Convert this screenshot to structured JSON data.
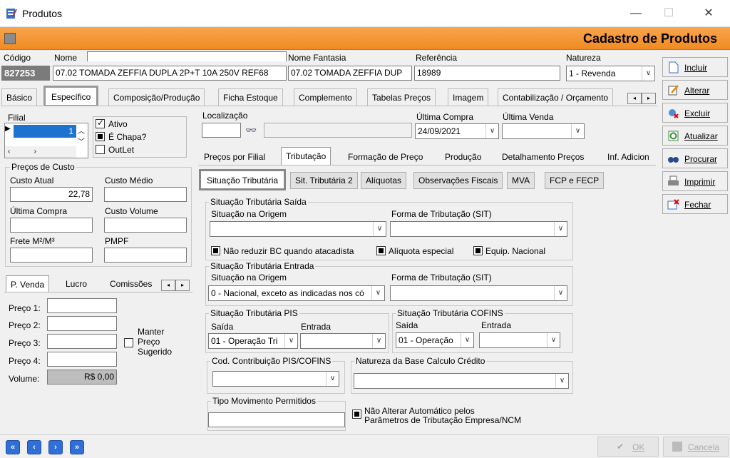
{
  "window": {
    "title": "Produtos"
  },
  "header": {
    "title": "Cadastro de Produtos"
  },
  "fields": {
    "codigo_label": "Código",
    "codigo": "827253",
    "nome_label": "Nome",
    "nome": "07.02 TOMADA ZEFFIA DUPLA 2P+T 10A 250V REF68",
    "fantasia_label": "Nome Fantasia",
    "fantasia": "07.02 TOMADA ZEFFIA DUP",
    "referencia_label": "Referência",
    "referencia": "18989",
    "natureza_label": "Natureza",
    "natureza": "1 - Revenda"
  },
  "tabs": [
    "Básico",
    "Específico",
    "Composição/Produção",
    "Ficha Estoque",
    "Complemento",
    "Tabelas Preços",
    "Imagem",
    "Contabilização / Orçamento"
  ],
  "left": {
    "filial_label": "Filial",
    "filial_value": "1",
    "ativo": "Ativo",
    "chapa": "É Chapa?",
    "outlet": "OutLet",
    "precos_custo": "Preços de Custo",
    "custo_atual_label": "Custo Atual",
    "custo_atual": "22,78",
    "custo_medio_label": "Custo Médio",
    "ultima_compra_label": "Última Compra",
    "custo_volume_label": "Custo Volume",
    "frete_label": "Frete M²/M³",
    "pmpf_label": "PMPF",
    "ptabs": [
      "P. Venda",
      "Lucro",
      "Comissões"
    ],
    "preco1": "Preço 1:",
    "preco2": "Preço 2:",
    "preco3": "Preço 3:",
    "preco4": "Preço 4:",
    "volume_label": "Volume:",
    "volume": "R$ 0,00",
    "manter": "Manter",
    "preco": "Preço",
    "sugerido": "Sugerido"
  },
  "right": {
    "localizacao": "Localização",
    "ultima_compra_label": "Última Compra",
    "ultima_compra": "24/09/2021",
    "ultima_venda_label": "Última Venda",
    "subtabs": [
      "Preços por Filial",
      "Tributação",
      "Formação de Preço",
      "Produção",
      "Detalhamento Preços",
      "Inf. Adicion"
    ],
    "btns": [
      "Situação Tributária",
      "Sit. Tributária 2",
      "Alíquotas",
      "Observações Fiscais",
      "MVA",
      "FCP e FECP"
    ],
    "saida_group": "Situação Tributária Saída",
    "sit_origem": "Situação na Origem",
    "forma_trib": "Forma de Tributação (SIT)",
    "nao_reduzir": "Não reduzir BC quando atacadista",
    "aliq_especial": "Alíquota especial",
    "equip_nacional": "Equip. Nacional",
    "entrada_group": "Situação Tributária Entrada",
    "entrada_origem_value": "0 - Nacional, exceto as indicadas nos có",
    "pis_group": "Situação Tributária PIS",
    "cofins_group": "Situação Tributária COFINS",
    "saida": "Saída",
    "entrada": "Entrada",
    "pis_saida": "01 - Operação Tri",
    "cofins_saida": "01 - Operação",
    "cod_contrib": "Cod. Contribuição PIS/COFINS",
    "natureza_base": "Natureza da Base Calculo Crédito",
    "tipo_mov": "Tipo Movimento Permitidos",
    "nao_alterar1": "Não Alterar Automático pelos",
    "nao_alterar2": "Parâmetros de Tributação Empresa/NCM"
  },
  "side": [
    "Incluir",
    "Alterar",
    "Excluir",
    "Atualizar",
    "Procurar",
    "Imprimir",
    "Fechar"
  ],
  "footer": {
    "ok": "OK",
    "cancel": "Cancela"
  }
}
